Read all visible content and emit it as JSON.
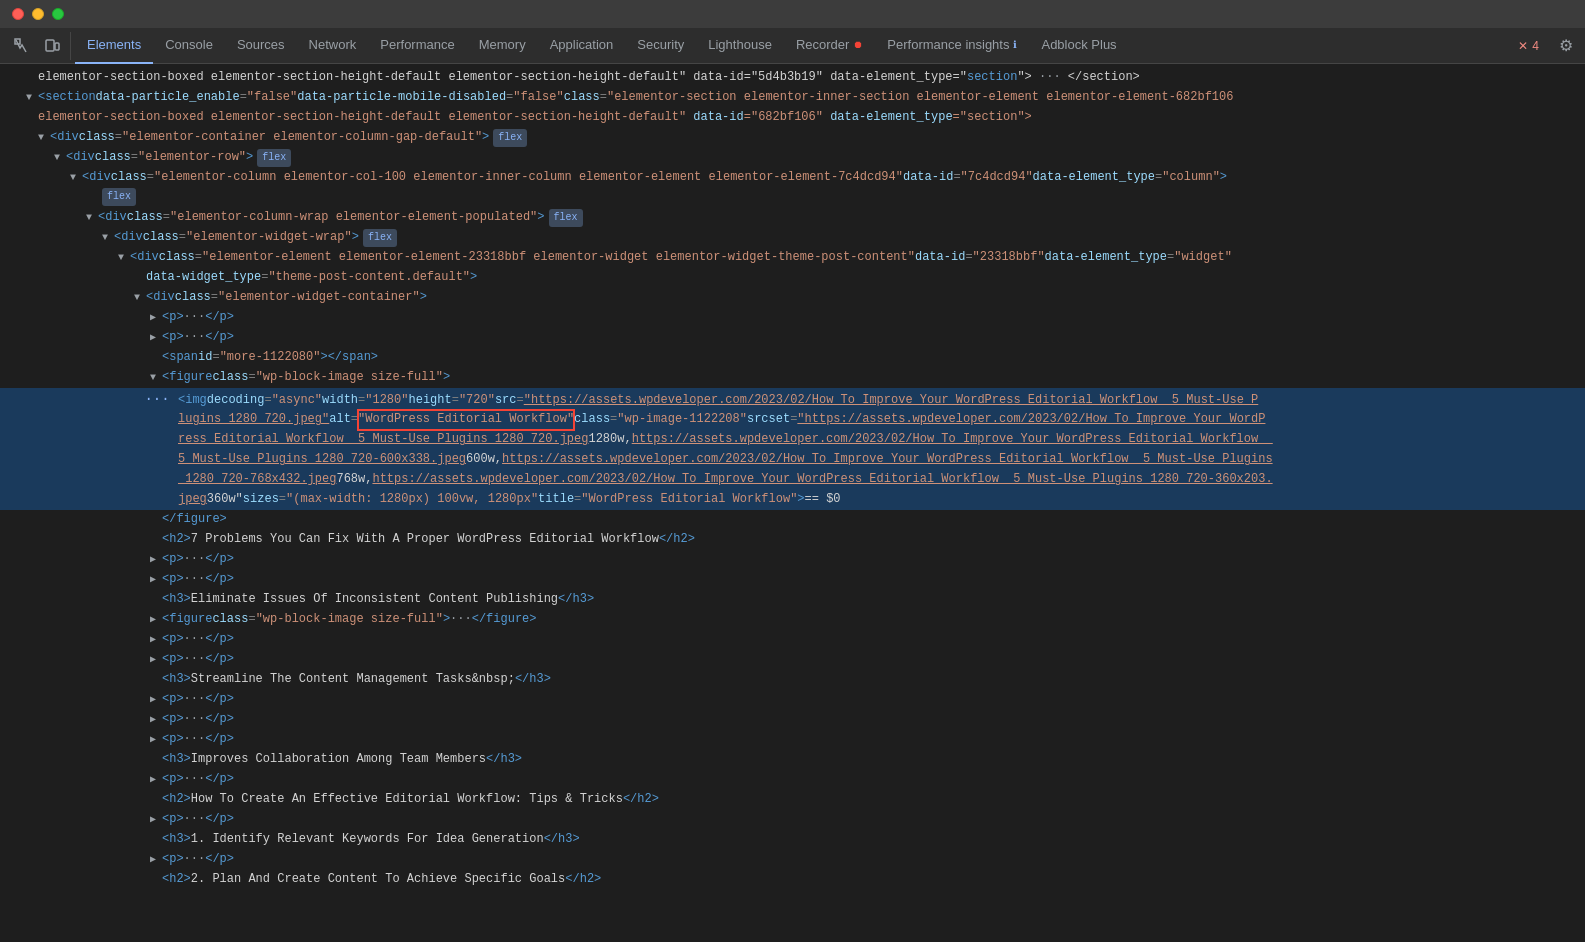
{
  "titleBar": {
    "lights": [
      "red",
      "yellow",
      "green"
    ]
  },
  "tabs": [
    {
      "id": "elements",
      "label": "Elements",
      "active": true,
      "badge": null
    },
    {
      "id": "console",
      "label": "Console",
      "active": false,
      "badge": null
    },
    {
      "id": "sources",
      "label": "Sources",
      "active": false,
      "badge": null
    },
    {
      "id": "network",
      "label": "Network",
      "active": false,
      "badge": null
    },
    {
      "id": "performance",
      "label": "Performance",
      "active": false,
      "badge": null
    },
    {
      "id": "memory",
      "label": "Memory",
      "active": false,
      "badge": null
    },
    {
      "id": "application",
      "label": "Application",
      "active": false,
      "badge": null
    },
    {
      "id": "security",
      "label": "Security",
      "active": false,
      "badge": null
    },
    {
      "id": "lighthouse",
      "label": "Lighthouse",
      "active": false,
      "badge": null
    },
    {
      "id": "recorder",
      "label": "Recorder 🔴",
      "active": false,
      "badge": null
    },
    {
      "id": "performance-insights",
      "label": "Performance insights 🔵",
      "active": false,
      "badge": null
    },
    {
      "id": "adblock-plus",
      "label": "Adblock Plus",
      "active": false,
      "badge": null
    }
  ],
  "errorBadge": "4",
  "codeLines": [
    {
      "id": "line1",
      "indent": 0,
      "arrow": "none",
      "prefix": "",
      "html": "elementor-section-boxed elementor-section-height-default elementor-section-height-default\" data-id=\"5d4b3b19\" data-element_type=\"section\">",
      "suffix": " ··· </section>",
      "selected": false,
      "hasDots": true
    },
    {
      "id": "line2",
      "indent": 0,
      "arrow": "expanded",
      "prefix": "<section",
      "attrPairs": [
        {
          "name": "data-particle_enable",
          "value": "\"false\""
        },
        {
          "name": "data-particle-mobile-disabled",
          "value": "\"false\""
        },
        {
          "name": "class",
          "value": "\"elementor-section elementor-inner-section elementor-element elementor-element-682bf106"
        }
      ],
      "suffix": "",
      "selected": false
    },
    {
      "id": "line3",
      "indent": 0,
      "arrow": "none",
      "content": "elementor-section-boxed elementor-section-height-default elementor-section-height-default\" data-id=\"682bf106\" data-element_type=\"section\">",
      "selected": false
    },
    {
      "id": "line4",
      "indent": 1,
      "arrow": "expanded",
      "tag": "div",
      "attrs": "class=\"elementor-container elementor-column-gap-default\"",
      "badge": "flex",
      "selected": false
    },
    {
      "id": "line5",
      "indent": 2,
      "arrow": "expanded",
      "tag": "div",
      "attrs": "class=\"elementor-row\"",
      "badge": "flex",
      "selected": false
    },
    {
      "id": "line6",
      "indent": 3,
      "arrow": "expanded",
      "tag": "div",
      "attrs": "class=\"elementor-column elementor-col-100 elementor-inner-column elementor-element elementor-element-7c4dcd94\" data-id=\"7c4dcd94\" data-element_type=\"column\"",
      "badge": null,
      "selected": false,
      "longLine": true
    },
    {
      "id": "line6b",
      "indent": 4,
      "arrow": "none",
      "badge": "flex",
      "isBadgeOnly": true,
      "selected": false
    },
    {
      "id": "line7",
      "indent": 4,
      "arrow": "expanded",
      "tag": "div",
      "attrs": "class=\"elementor-column-wrap elementor-element-populated\"",
      "badge": "flex",
      "selected": false
    },
    {
      "id": "line8",
      "indent": 5,
      "arrow": "expanded",
      "tag": "div",
      "attrs": "class=\"elementor-widget-wrap\"",
      "badge": "flex",
      "selected": false
    },
    {
      "id": "line9",
      "indent": 6,
      "arrow": "expanded",
      "tag": "div",
      "attrs": "class=\"elementor-element elementor-element-23318bbf elementor-widget elementor-widget-theme-post-content\" data-id=\"23318bbf\" data-element_type=\"widget\"",
      "badge": null,
      "selected": false,
      "longLine": true
    },
    {
      "id": "line10",
      "indent": 7,
      "arrow": "none",
      "content": "data-widget_type=\"theme-post-content.default\">",
      "selected": false
    },
    {
      "id": "line11",
      "indent": 7,
      "arrow": "expanded",
      "tag": "div",
      "attrs": "class=\"elementor-widget-container\"",
      "badge": null,
      "selected": false
    },
    {
      "id": "line12",
      "indent": 8,
      "arrow": "collapsed",
      "tag": "p",
      "content": " ··· </p>",
      "selected": false
    },
    {
      "id": "line13",
      "indent": 8,
      "arrow": "collapsed",
      "tag": "p",
      "content": " ··· </p>",
      "selected": false
    },
    {
      "id": "line14",
      "indent": 8,
      "arrow": "none",
      "content": "<span id=\"more-1122080\"></span>",
      "selected": false
    },
    {
      "id": "line15",
      "indent": 8,
      "arrow": "expanded",
      "tag": "figure",
      "attrs": "class=\"wp-block-image size-full\"",
      "selected": false
    },
    {
      "id": "line16",
      "indent": 9,
      "isImgLine": true,
      "selected": true,
      "highlighted": true,
      "hasDots": true
    },
    {
      "id": "line17",
      "indent": 9,
      "isAltHighlighted": true,
      "selected": true,
      "highlighted": true
    },
    {
      "id": "line18",
      "indent": 9,
      "isSrcset1": true,
      "selected": true,
      "highlighted": true
    },
    {
      "id": "line19",
      "indent": 9,
      "isSrcset2": true,
      "selected": true,
      "highlighted": true
    },
    {
      "id": "line20",
      "indent": 9,
      "isSrcset3": true,
      "selected": true,
      "highlighted": true
    },
    {
      "id": "line21",
      "indent": 9,
      "isTitleEq": true,
      "selected": true,
      "highlighted": true
    },
    {
      "id": "line22",
      "indent": 8,
      "content": "</figure>",
      "selected": false
    },
    {
      "id": "line23",
      "indent": 8,
      "arrow": "none",
      "isH2": true,
      "content": "<h2>7 Problems You Can Fix With A Proper WordPress Editorial Workflow</h2>",
      "selected": false
    },
    {
      "id": "line24",
      "indent": 8,
      "arrow": "collapsed",
      "tag": "p",
      "content": " ··· </p>",
      "selected": false
    },
    {
      "id": "line25",
      "indent": 8,
      "arrow": "collapsed",
      "tag": "p",
      "content": " ··· </p>",
      "selected": false
    },
    {
      "id": "line26",
      "indent": 8,
      "arrow": "none",
      "isH3": true,
      "content": "<h3>Eliminate Issues Of Inconsistent Content Publishing</h3>",
      "selected": false
    },
    {
      "id": "line27",
      "indent": 8,
      "arrow": "collapsed",
      "tag": "figure",
      "attrs": "class=\"wp-block-image size-full\"",
      "ellipsis": " ··· </figure>",
      "selected": false
    },
    {
      "id": "line28",
      "indent": 8,
      "arrow": "collapsed",
      "tag": "p",
      "content": " ··· </p>",
      "selected": false
    },
    {
      "id": "line29",
      "indent": 8,
      "arrow": "collapsed",
      "tag": "p",
      "content": " ··· </p>",
      "selected": false
    },
    {
      "id": "line30",
      "indent": 8,
      "arrow": "none",
      "isH3": true,
      "content": "<h3>Streamline The Content Management Tasks&nbsp;</h3>",
      "selected": false
    },
    {
      "id": "line31",
      "indent": 8,
      "arrow": "collapsed",
      "tag": "p",
      "content": " ··· </p>",
      "selected": false
    },
    {
      "id": "line32",
      "indent": 8,
      "arrow": "collapsed",
      "tag": "p",
      "content": " ··· </p>",
      "selected": false
    },
    {
      "id": "line33",
      "indent": 8,
      "arrow": "collapsed",
      "tag": "p",
      "content": " ··· </p>",
      "selected": false
    },
    {
      "id": "line34",
      "indent": 8,
      "arrow": "none",
      "isH3": true,
      "content": "<h3>Improves Collaboration Among Team Members</h3>",
      "selected": false
    },
    {
      "id": "line35",
      "indent": 8,
      "arrow": "collapsed",
      "tag": "p",
      "content": " ··· </p>",
      "selected": false
    },
    {
      "id": "line36",
      "indent": 8,
      "arrow": "none",
      "isH2": true,
      "content": "<h2>How To Create An Effective Editorial Workflow: Tips & Tricks</h2>",
      "selected": false
    },
    {
      "id": "line37",
      "indent": 8,
      "arrow": "collapsed",
      "tag": "p",
      "content": " ··· </p>",
      "selected": false
    },
    {
      "id": "line38",
      "indent": 8,
      "arrow": "none",
      "isH3": true,
      "content": "<h3>1. Identify Relevant Keywords For Idea Generation</h3>",
      "selected": false
    },
    {
      "id": "line39",
      "indent": 8,
      "arrow": "collapsed",
      "tag": "p",
      "content": " ··· </p>",
      "selected": false
    },
    {
      "id": "line40",
      "indent": 8,
      "arrow": "none",
      "isH2": true,
      "content": "<h2>2. Plan And Create Content To Achieve Specific Goals</h2>",
      "selected": false
    }
  ]
}
